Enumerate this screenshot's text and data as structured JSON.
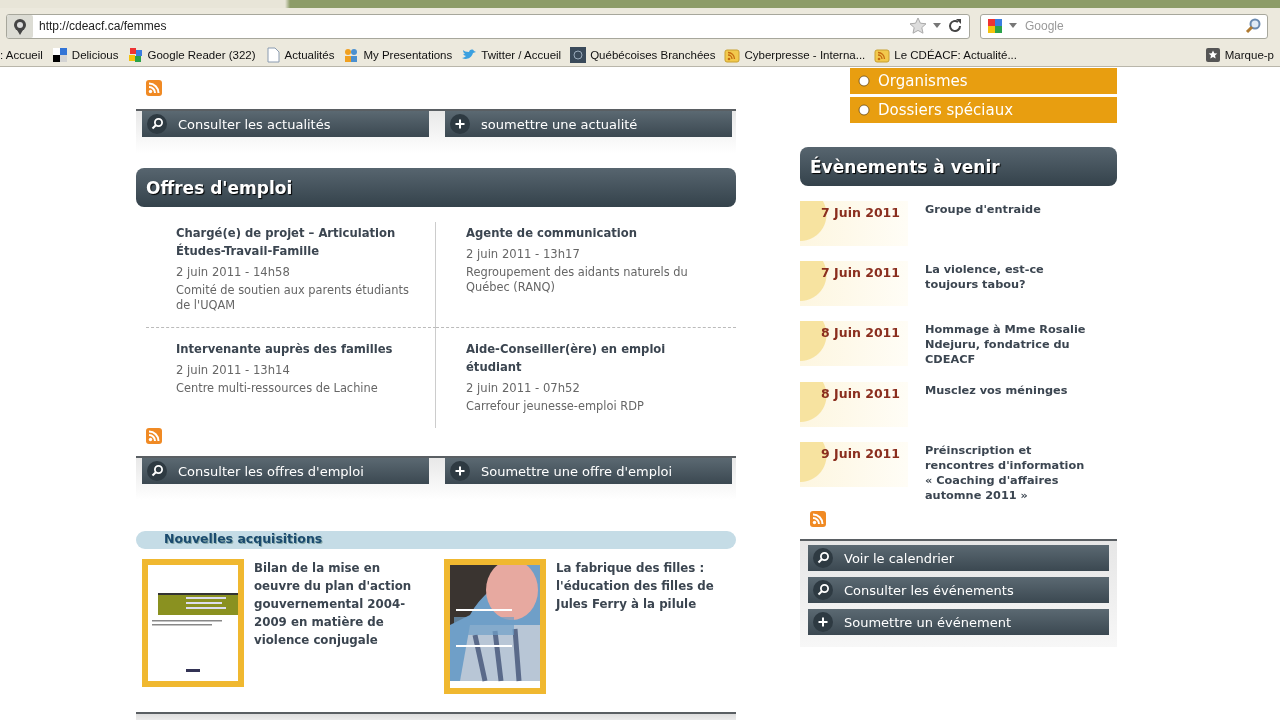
{
  "browser": {
    "url": "http://cdeacf.ca/femmes",
    "search_placeholder": "Google",
    "bookmarks": [
      {
        "label": ": Accueil",
        "kind": "none"
      },
      {
        "label": "Delicious",
        "kind": "squares"
      },
      {
        "label": "Google Reader (322)",
        "kind": "blocks"
      },
      {
        "label": "Actualités",
        "kind": "page"
      },
      {
        "label": "My Presentations",
        "kind": "people"
      },
      {
        "label": "Twitter / Accueil",
        "kind": "bird"
      },
      {
        "label": "Québécoises Branchées",
        "kind": "site"
      },
      {
        "label": "Cyberpresse - Interna...",
        "kind": "feed"
      },
      {
        "label": "Le CDÉACF: Actualité...",
        "kind": "feed"
      }
    ],
    "bookmarks_menu": {
      "label": "Marque-p"
    }
  },
  "news_buttons": [
    {
      "label": "Consulter les actualités",
      "kind": "search"
    },
    {
      "label": "soumettre une actualité",
      "kind": "add"
    }
  ],
  "jobs": {
    "title": "Offres d'emploi",
    "items": [
      {
        "title": "Chargé(e) de projet – Articulation Études-Travail-Famille",
        "date": "2 juin 2011 - 14h58",
        "org": "Comité de soutien aux parents étudiants de l'UQAM"
      },
      {
        "title": "Agente de communication",
        "date": "2 juin 2011 - 13h17",
        "org": "Regroupement des aidants naturels du Québec (RANQ)"
      },
      {
        "title": "Intervenante auprès des familles",
        "date": "2 juin 2011 - 13h14",
        "org": "Centre multi-ressources de Lachine"
      },
      {
        "title": "Aide-Conseiller(ère) en emploi étudiant",
        "date": "2 juin 2011 - 07h52",
        "org": "Carrefour jeunesse-emploi RDP"
      }
    ],
    "buttons": [
      {
        "label": "Consulter les offres d'emploi",
        "kind": "search"
      },
      {
        "label": "Soumettre une offre d'emploi",
        "kind": "add"
      }
    ]
  },
  "acquisitions": {
    "title": "Nouvelles acquisitions",
    "books": [
      {
        "title": "Bilan de la mise en oeuvre du plan d'action gouvernemental 2004-2009 en matière de violence conjugale",
        "kind": "report"
      },
      {
        "title": "La fabrique des filles : l'éducation des filles de Jules Ferry à la pilule",
        "kind": "portrait"
      }
    ]
  },
  "sidebar_menu": [
    {
      "label": "Organismes"
    },
    {
      "label": "Dossiers spéciaux"
    }
  ],
  "events": {
    "title": "Évènements à venir",
    "items": [
      {
        "date": "7 Juin 2011",
        "title": "Groupe d'entraide"
      },
      {
        "date": "7 Juin 2011",
        "title": "La violence, est-ce toujours tabou?"
      },
      {
        "date": "8 Juin 2011",
        "title": "Hommage à Mme Rosalie Ndejuru, fondatrice du CDEACF"
      },
      {
        "date": "8 Juin 2011",
        "title": "Musclez vos méninges"
      },
      {
        "date": "9 Juin 2011",
        "title": "Préinscription et rencontres d'information « Coaching d'affaires automne 2011 »"
      }
    ],
    "buttons": [
      {
        "label": "Voir le calendrier",
        "kind": "search"
      },
      {
        "label": "Consulter les événements",
        "kind": "search"
      },
      {
        "label": "Soumettre un événement",
        "kind": "add"
      }
    ]
  }
}
